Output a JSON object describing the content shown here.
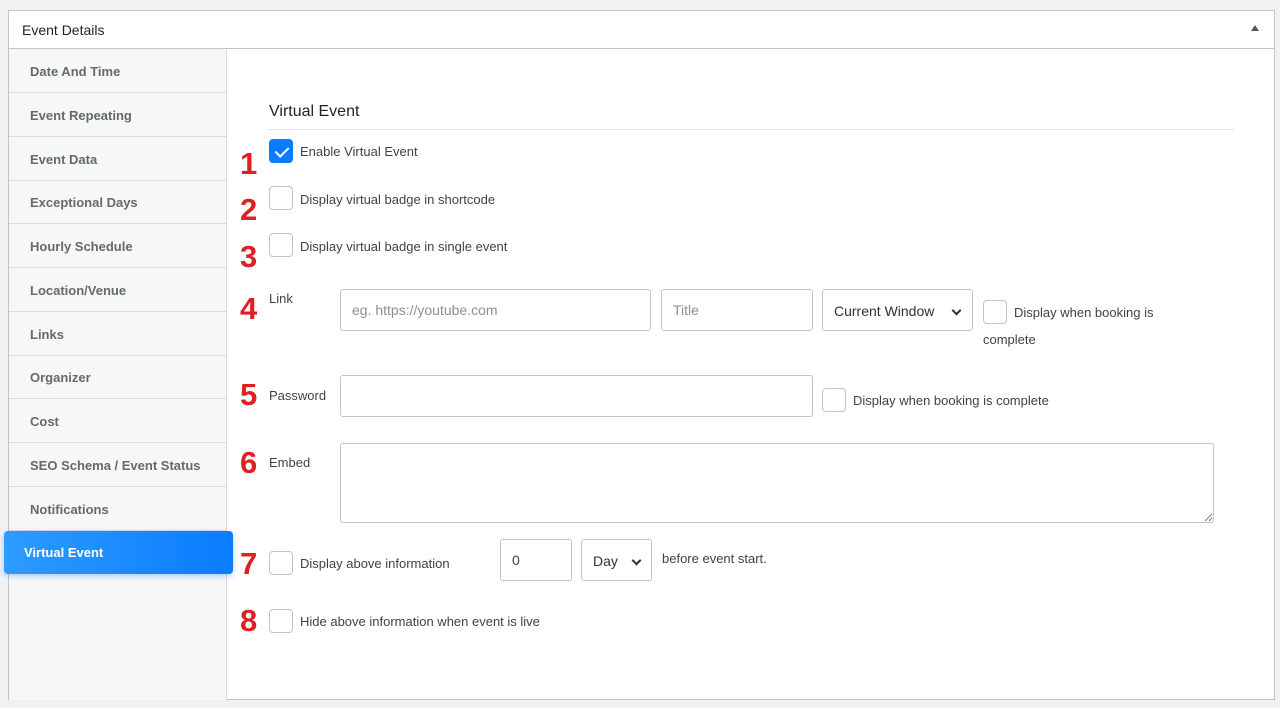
{
  "panel": {
    "title": "Event Details"
  },
  "sidebar": {
    "items": [
      {
        "label": "Date And Time"
      },
      {
        "label": "Event Repeating"
      },
      {
        "label": "Event Data"
      },
      {
        "label": "Exceptional Days"
      },
      {
        "label": "Hourly Schedule"
      },
      {
        "label": "Location/Venue"
      },
      {
        "label": "Links"
      },
      {
        "label": "Organizer"
      },
      {
        "label": "Cost"
      },
      {
        "label": "SEO Schema / Event Status"
      },
      {
        "label": "Notifications"
      },
      {
        "label": "Virtual Event"
      }
    ],
    "active_index": 11
  },
  "main": {
    "section_title": "Virtual Event",
    "markers": [
      "1",
      "2",
      "3",
      "4",
      "5",
      "6",
      "7",
      "8"
    ],
    "enable_virtual": {
      "label": "Enable Virtual Event",
      "checked": true
    },
    "badge_shortcode": {
      "label": "Display virtual badge in shortcode",
      "checked": false
    },
    "badge_single": {
      "label": "Display virtual badge in single event",
      "checked": false
    },
    "link": {
      "label": "Link",
      "url_placeholder": "eg. https://youtube.com",
      "url_value": "",
      "title_placeholder": "Title",
      "title_value": "",
      "target_selected": "Current Window",
      "display_booking_line1": "Display when booking is",
      "display_booking_line2": "complete",
      "display_booking_checked": false
    },
    "password": {
      "label": "Password",
      "value": "",
      "display_booking_label": "Display when booking is complete",
      "display_booking_checked": false
    },
    "embed": {
      "label": "Embed",
      "value": ""
    },
    "display_above": {
      "label": "Display above information",
      "checked": false,
      "amount": "0",
      "unit_selected": "Day",
      "suffix": "before event start."
    },
    "hide_live": {
      "label": "Hide above information when event is live",
      "checked": false
    }
  },
  "colors": {
    "accent": "#0a7cff",
    "marker": "#e02020"
  }
}
